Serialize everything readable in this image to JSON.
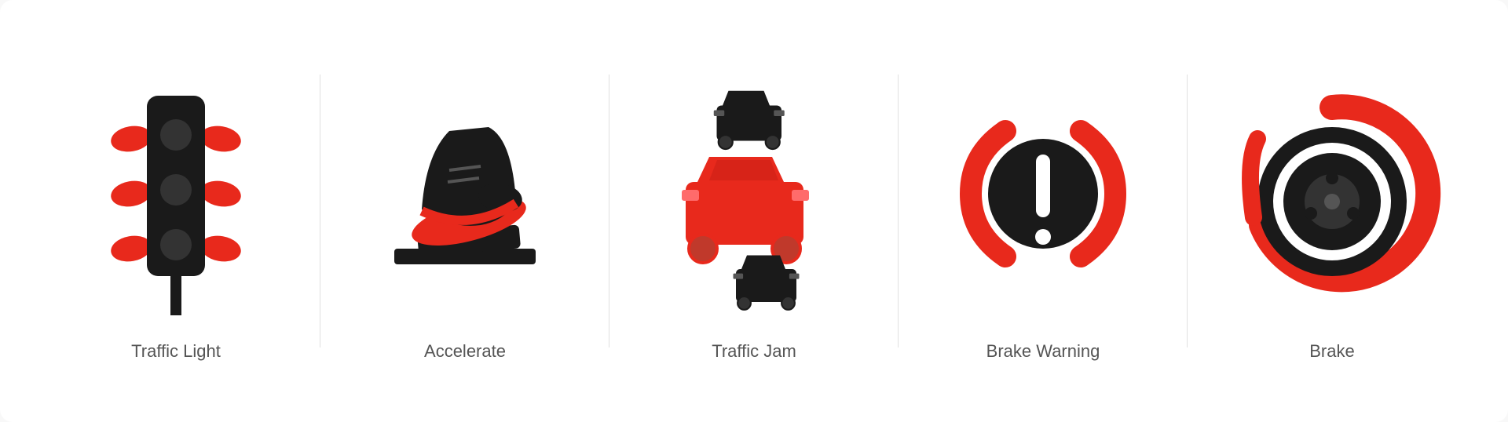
{
  "icons": [
    {
      "id": "traffic-light",
      "label": "Traffic Light"
    },
    {
      "id": "accelerate",
      "label": "Accelerate"
    },
    {
      "id": "traffic-jam",
      "label": "Traffic Jam"
    },
    {
      "id": "brake-warning",
      "label": "Brake Warning"
    },
    {
      "id": "brake",
      "label": "Brake"
    }
  ],
  "colors": {
    "red": "#e8291c",
    "black": "#1a1a1a",
    "gray": "#555555"
  }
}
